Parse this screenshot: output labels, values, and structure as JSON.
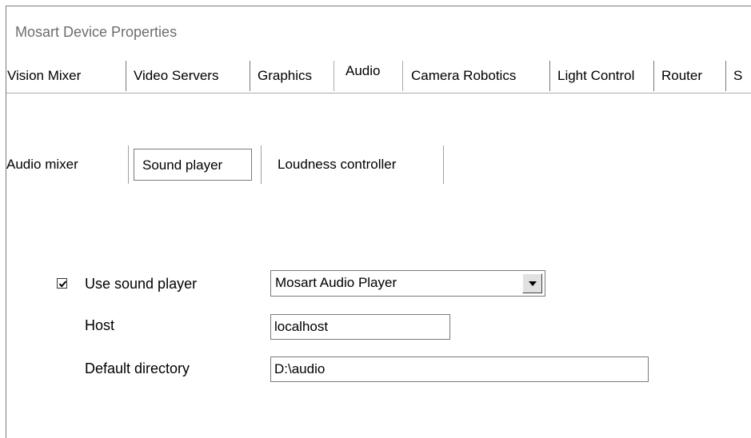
{
  "window": {
    "title": "Mosart Device Properties"
  },
  "tabs": [
    {
      "label": "Vision Mixer",
      "active": false
    },
    {
      "label": "Video Servers",
      "active": false
    },
    {
      "label": "Graphics",
      "active": false
    },
    {
      "label": "Audio",
      "active": true
    },
    {
      "label": "Camera Robotics",
      "active": false
    },
    {
      "label": "Light Control",
      "active": false
    },
    {
      "label": "Router",
      "active": false
    },
    {
      "label": "S",
      "active": false
    }
  ],
  "subtabs": [
    {
      "label": "Audio mixer",
      "selected": false
    },
    {
      "label": "Sound player",
      "selected": true
    },
    {
      "label": "Loudness controller",
      "selected": false
    }
  ],
  "sound_player": {
    "use_label": "Use sound player",
    "use_checked": true,
    "player_value": "Mosart Audio Player",
    "host_label": "Host",
    "host_value": "localhost",
    "directory_label": "Default directory",
    "directory_value": "D:\\audio"
  },
  "icons": {
    "check": "checkmark-icon",
    "dropdown": "triangle-down-icon"
  }
}
